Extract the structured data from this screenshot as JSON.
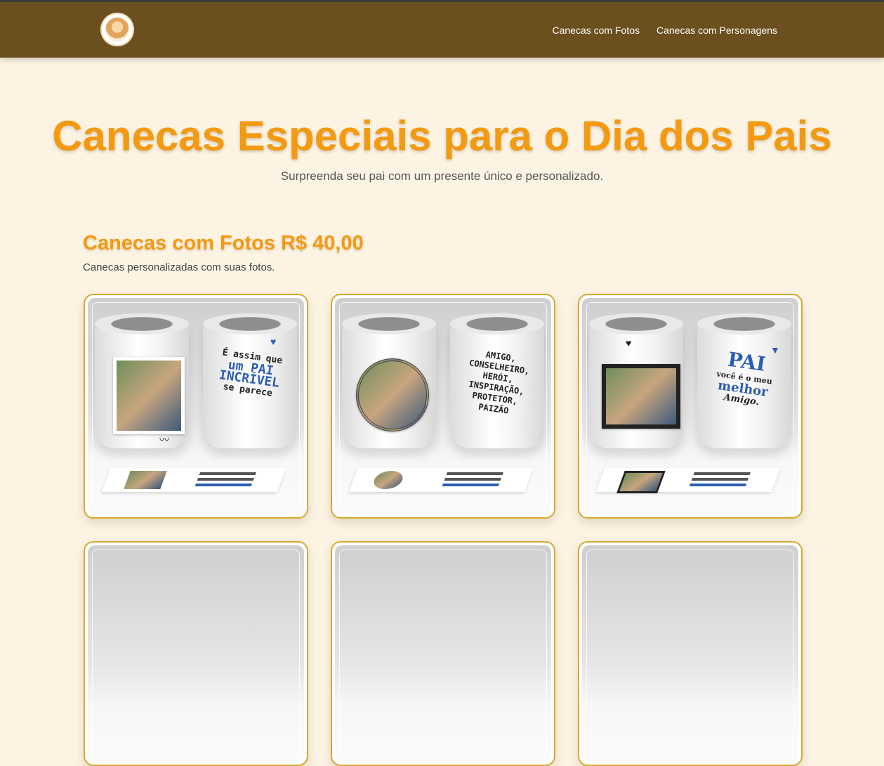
{
  "nav": {
    "logo_alt": "logo",
    "links": [
      "Canecas com Fotos",
      "Canecas com Personagens"
    ]
  },
  "hero": {
    "title": "Canecas Especiais para o Dia dos Pais",
    "subtitle": "Surpreenda seu pai com um presente único e personalizado."
  },
  "section": {
    "title": "Canecas com Fotos R$ 40,00",
    "description": "Canecas personalizadas com suas fotos."
  },
  "cards": [
    {
      "mug_text_1": "É assim que",
      "mug_text_2": "um PAI",
      "mug_text_3": "INCRÍVEL",
      "mug_text_4": "se parece"
    },
    {
      "mug_text_1": "AMIGO,",
      "mug_text_2": "CONSELHEIRO,",
      "mug_text_3": "HERÓI,",
      "mug_text_4": "INSPIRAÇÃO, PROTETOR, PAIZÃO"
    },
    {
      "mug_text_1": "PAI",
      "mug_text_2": "você é o meu",
      "mug_text_3": "melhor",
      "mug_text_4": "Amigo."
    }
  ],
  "colors": {
    "navbar": "#6b4f1e",
    "background": "#fdf3e2",
    "accent": "#f39a10",
    "card_border": "#d9a92c"
  }
}
